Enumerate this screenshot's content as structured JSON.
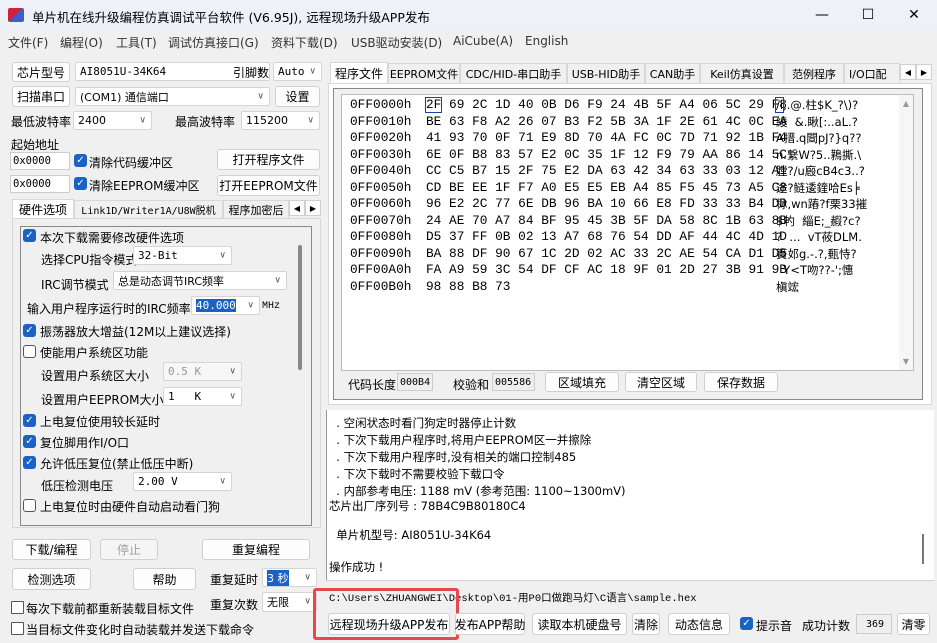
{
  "window": {
    "title": "单片机在线升级编程仿真调试平台软件 (V6.95J), 远程现场升级APP发布",
    "minimize": "—",
    "maximize": "☐",
    "close": "✕"
  },
  "menu": [
    "文件(F)",
    "编程(O)",
    "工具(T)",
    "调试仿真接口(G)",
    "资料下载(D)",
    "USB驱动安装(D)",
    "AiCube(A)",
    "English"
  ],
  "left": {
    "chip_btn": "芯片型号",
    "chip_value": "AI8051U-34K64",
    "pins_label": "引脚数",
    "pins_value": "Auto",
    "scan_btn": "扫描串口",
    "port_value": "(COM1) 通信端口",
    "settings_btn": "设置",
    "min_baud_label": "最低波特率",
    "min_baud": "2400",
    "max_baud_label": "最高波特率",
    "max_baud": "115200",
    "start_addr_label": "起始地址",
    "addr1": "0x0000",
    "clear_code": "清除代码缓冲区",
    "addr2": "0x0000",
    "clear_eeprom": "清除EEPROM缓冲区",
    "open_prog": "打开程序文件",
    "open_eeprom": "打开EEPROM文件",
    "tabs": [
      "硬件选项",
      "Link1D/Writer1A/U8W脱机",
      "程序加密后"
    ],
    "hw": {
      "modify": "本次下载需要修改硬件选项",
      "cpu_label": "选择CPU指令模式",
      "cpu_value": "32-Bit",
      "irc_label": "IRC调节模式",
      "irc_value": "总是动态调节IRC频率",
      "freq_label": "输入用户程序运行时的IRC频率",
      "freq_value": "40.000",
      "freq_unit": "MHz",
      "osc_gain": "振荡器放大增益(12M以上建议选择)",
      "user_sys": "使能用户系统区功能",
      "sys_size_label": "设置用户系统区大小",
      "sys_size": "0.5 K",
      "eeprom_size_label": "设置用户EEPROM大小",
      "eeprom_size": "1   K",
      "long_delay": "上电复位使用较长延时",
      "reset_io": "复位脚用作I/O口",
      "low_volt_reset": "允许低压复位(禁止低压中断)",
      "lv_label": "低压检测电压",
      "lv_value": "2.00 V",
      "watchdog": "上电复位时由硬件自动启动看门狗"
    },
    "download_btn": "下载/编程",
    "stop_btn": "停止",
    "repeat_btn": "重复编程",
    "check_btn": "检测选项",
    "help_btn": "帮助",
    "repeat_delay_label": "重复延时",
    "repeat_delay": "3 秒",
    "repeat_count_label": "重复次数",
    "repeat_count": "无限",
    "reload_each": "每次下载前都重新装载目标文件",
    "auto_reload": "当目标文件变化时自动装载并发送下载命令"
  },
  "right": {
    "tabs": [
      "程序文件",
      "EEPROM文件",
      "CDC/HID-串口助手",
      "USB-HID助手",
      "CAN助手",
      "Keil仿真设置",
      "范例程序",
      "I/O口配"
    ],
    "hex": [
      {
        "addr": "0FF0000h",
        "bytes": "2F 69 2C 1D 40 0B D6 F9 24 4B 5F A4 06 5C 29 F8",
        "ascii": "/i,.@.柱$K_?\\)?"
      },
      {
        "addr": "0FF0010h",
        "bytes": "BE 63 F8 A2 26 07 B3 F2 5B 3A 1F 2E 61 4C 0C EA",
        "ascii": "綾  &.瞅[:..aL.?"
      },
      {
        "addr": "0FF0020h",
        "bytes": "41 93 70 0F 71 E9 8D 70 4A FC 0C 7D 71 92 1B F4",
        "ascii": "A搢.q閸pJ?}q??"
      },
      {
        "addr": "0FF0030h",
        "bytes": "6E 0F B8 83 57 E2 0C 35 1F 12 F9 79 AA 86 14 5C",
        "ascii": "n.繋W?5..鶜撕.\\"
      },
      {
        "addr": "0FF0040h",
        "bytes": "CC C5 B7 15 2F 75 E2 DA 63 42 34 63 33 03 12 A1",
        "ascii": "膛?/u廏cB4c3..?"
      },
      {
        "addr": "0FF0050h",
        "bytes": "CD BE EE 1F F7 A0 E5 E5 EB A4 85 F5 45 73 A5 C8",
        "ascii": "途?鲢逶鍷哈Es╞"
      },
      {
        "addr": "0FF0060h",
        "bytes": "96 E2 2C 77 6E DB 96 BA 10 66 E8 FD 33 33 B4 DD",
        "ascii": "栤,wn蹖?f栗33摧"
      },
      {
        "addr": "0FF0070h",
        "bytes": "24 AE 70 A7 84 BF 95 45 3B 5F DA 58 8C 1B 63 8B",
        "ascii": "$畃  緇E;_赮?c?"
      },
      {
        "addr": "0FF0080h",
        "bytes": "D5 37 FF 0B 02 13 A7 68 76 54 DD AF 44 4C 4D 1D",
        "ascii": "?  ...  vT莜DLM."
      },
      {
        "addr": "0FF0090h",
        "bytes": "BA 88 DF 90 67 1C 2D 02 AC 33 2C AE 54 CA D1 D5",
        "ascii": "簣邚g.-.?,甀恃?"
      },
      {
        "addr": "0FF00A0h",
        "bytes": "FA A9 59 3C 54 DF CF AC 18 9F 01 2D 27 3B 91 9B",
        "ascii": "  Y<T吻??-';憓"
      },
      {
        "addr": "0FF00B0h",
        "bytes": "98 88 B8 73",
        "ascii": "槇竤"
      }
    ],
    "code_len_label": "代码长度",
    "code_len": "000B4",
    "checksum_label": "校验和",
    "checksum": "005586",
    "fill_btn": "区域填充",
    "clear_area_btn": "清空区域",
    "save_btn": "保存数据",
    "log": [
      "  . 空闲状态时看门狗定时器停止计数",
      "  . 下次下载用户程序时,将用户EEPROM区一并擦除",
      "  . 下次下载用户程序时,没有相关的端口控制485",
      "  . 下次下载时不需要校验下载口令",
      "  . 内部参考电压: 1188 mV (参考范围: 1100~1300mV)",
      "芯片出厂序列号 : 78B4C9B80180C4",
      "",
      "  单片机型号: AI8051U-34K64",
      "",
      "操作成功 !"
    ],
    "path": "C:\\Users\\ZHUANGWEI\\Desktop\\01-用P0口做跑马灯\\C语言\\sample.hex",
    "remote_btn": "远程现场升级APP发布",
    "publish_help_btn": "发布APP帮助",
    "read_disk_btn": "读取本机硬盘号",
    "clear_btn": "清除",
    "dyn_btn": "动态信息",
    "beep_label": "提示音",
    "success_label": "成功计数",
    "success_count": "369",
    "reset_btn": "清零"
  },
  "colors": {
    "accent": "#1a62c4",
    "highlight": "#e5484d"
  }
}
